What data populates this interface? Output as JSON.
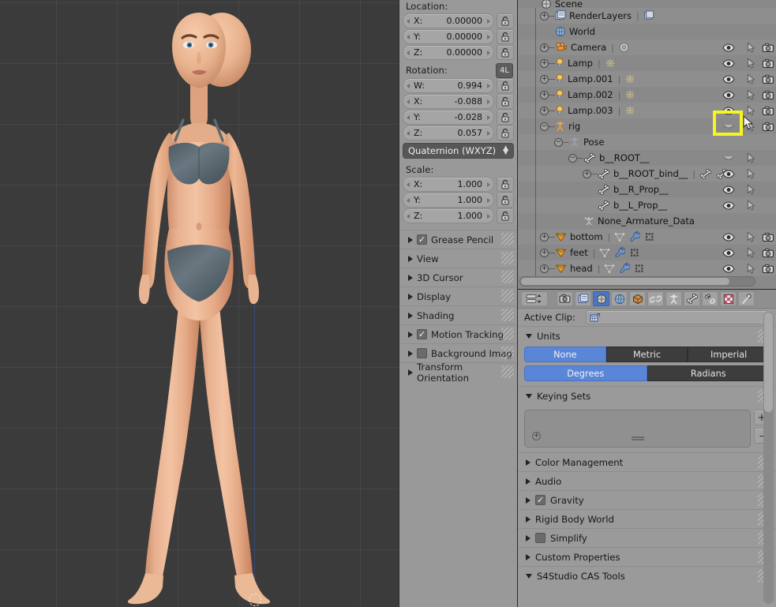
{
  "viewport": {
    "name": "3d-viewport",
    "background_color": "#3b3b3b",
    "grid_color": "#4a4a4a",
    "z_axis_color": "#3a4a7a",
    "skin_color": "#e8b591",
    "garment_color": "#5d6a72",
    "subject": "female character mesh in underwear, front view, T-pose arms down"
  },
  "npanel": {
    "location": {
      "label": "Location:",
      "fields": [
        {
          "name": "X:",
          "value": "0.00000"
        },
        {
          "name": "Y:",
          "value": "0.00000"
        },
        {
          "name": "Z:",
          "value": "0.00000"
        }
      ]
    },
    "rotation": {
      "label": "Rotation:",
      "layer_button": "4L",
      "fields": [
        {
          "name": "W:",
          "value": "0.994"
        },
        {
          "name": "X:",
          "value": "-0.088"
        },
        {
          "name": "Y:",
          "value": "-0.028"
        },
        {
          "name": "Z:",
          "value": "0.057"
        }
      ],
      "mode": "Quaternion (WXYZ)"
    },
    "scale": {
      "label": "Scale:",
      "fields": [
        {
          "name": "X:",
          "value": "1.000"
        },
        {
          "name": "Y:",
          "value": "1.000"
        },
        {
          "name": "Z:",
          "value": "1.000"
        }
      ]
    },
    "panels": [
      {
        "label": "Grease Pencil",
        "open": false,
        "checkbox": true,
        "checked": true
      },
      {
        "label": "View",
        "open": false,
        "checkbox": false
      },
      {
        "label": "3D Cursor",
        "open": false,
        "checkbox": false
      },
      {
        "label": "Display",
        "open": false,
        "checkbox": false
      },
      {
        "label": "Shading",
        "open": false,
        "checkbox": false
      },
      {
        "label": "Motion Tracking",
        "open": false,
        "checkbox": true,
        "checked": true
      },
      {
        "label": "Background Imag",
        "open": false,
        "checkbox": true,
        "checked": false
      },
      {
        "label": "Transform Orientation",
        "open": false,
        "checkbox": false
      }
    ]
  },
  "outliner": {
    "name": "outliner-editor",
    "rows": [
      {
        "label": "Scene",
        "icon": "scene-icon",
        "indent": 0,
        "expand": "none",
        "clipped": true,
        "eye": false,
        "select": false,
        "render": false,
        "extras": []
      },
      {
        "label": "RenderLayers",
        "icon": "renderlayers-icon",
        "indent": 1,
        "expand": "plus",
        "eye": false,
        "select": false,
        "render": false,
        "extras": [
          "renderlayer-data-icon"
        ]
      },
      {
        "label": "World",
        "icon": "world-icon",
        "indent": 1,
        "expand": "none",
        "eye": false,
        "select": false,
        "render": false,
        "extras": []
      },
      {
        "label": "Camera",
        "icon": "camera-object-icon",
        "indent": 1,
        "expand": "plus",
        "eye": true,
        "select": true,
        "render": true,
        "extras": [
          "camera-data-icon"
        ]
      },
      {
        "label": "Lamp",
        "icon": "lamp-object-icon",
        "indent": 1,
        "expand": "plus",
        "eye": true,
        "select": true,
        "render": true,
        "extras": [
          "lamp-data-icon"
        ]
      },
      {
        "label": "Lamp.001",
        "icon": "lamp-object-icon",
        "indent": 1,
        "expand": "plus",
        "eye": true,
        "select": true,
        "render": true,
        "extras": [
          "lamp-data-icon"
        ]
      },
      {
        "label": "Lamp.002",
        "icon": "lamp-object-icon",
        "indent": 1,
        "expand": "plus",
        "eye": true,
        "select": true,
        "render": true,
        "extras": [
          "lamp-data-icon"
        ]
      },
      {
        "label": "Lamp.003",
        "icon": "lamp-object-icon",
        "indent": 1,
        "expand": "plus",
        "eye": true,
        "select": true,
        "render": true,
        "extras": [
          "lamp-data-icon"
        ]
      },
      {
        "label": "rig",
        "icon": "armature-object-icon",
        "indent": 1,
        "expand": "minus",
        "eye": true,
        "eye_closed": true,
        "select": true,
        "render": true,
        "extras": [],
        "highlighted": true
      },
      {
        "label": "Pose",
        "icon": "pose-icon",
        "indent": 2,
        "expand": "minus",
        "eye": false,
        "select": false,
        "render": false,
        "extras": []
      },
      {
        "label": "b__ROOT__",
        "icon": "bone-icon",
        "indent": 3,
        "expand": "minus",
        "eye": true,
        "eye_closed": true,
        "select": true,
        "render": false,
        "extras": []
      },
      {
        "label": "b__ROOT_bind__",
        "icon": "bone-icon",
        "indent": 4,
        "expand": "plus",
        "eye": true,
        "select": true,
        "render": false,
        "extras": [
          "bone-icon",
          "bone-icon"
        ]
      },
      {
        "label": "b__R_Prop__",
        "icon": "bone-icon",
        "indent": 4,
        "expand": "none",
        "eye": true,
        "select": true,
        "render": false,
        "extras": []
      },
      {
        "label": "b__L_Prop__",
        "icon": "bone-icon",
        "indent": 4,
        "expand": "none",
        "eye": true,
        "select": true,
        "render": false,
        "extras": []
      },
      {
        "label": "None_Armature_Data",
        "icon": "armature-data-icon",
        "indent": 3,
        "expand": "none",
        "eye": false,
        "select": false,
        "render": false,
        "extras": []
      },
      {
        "label": "bottom",
        "icon": "mesh-object-icon",
        "indent": 1,
        "expand": "plus",
        "eye": true,
        "select": true,
        "render": true,
        "extras": [
          "mesh-data-icon",
          "modifier-icon",
          "vertexgroup-icon"
        ]
      },
      {
        "label": "feet",
        "icon": "mesh-object-icon",
        "indent": 1,
        "expand": "plus",
        "eye": true,
        "select": true,
        "render": true,
        "extras": [
          "mesh-data-icon",
          "modifier-icon",
          "vertexgroup-icon"
        ]
      },
      {
        "label": "head",
        "icon": "mesh-object-icon",
        "indent": 1,
        "expand": "plus",
        "eye": true,
        "select": true,
        "render": true,
        "extras": [
          "mesh-data-icon",
          "modifier-icon",
          "vertexgroup-icon"
        ]
      }
    ],
    "highlight_color": "#f5f522"
  },
  "properties": {
    "name": "properties-editor",
    "tabs": [
      {
        "name": "render-tab",
        "icon": "camera-back-icon",
        "active": false
      },
      {
        "name": "renderlayers-tab",
        "icon": "renderlayers-icon",
        "active": false
      },
      {
        "name": "scene-tab",
        "icon": "scene-icon",
        "active": true
      },
      {
        "name": "world-tab",
        "icon": "world-icon",
        "active": false
      },
      {
        "name": "object-tab",
        "icon": "cube-icon",
        "active": false
      },
      {
        "name": "constraints-tab",
        "icon": "chain-icon",
        "active": false
      },
      {
        "name": "armature-tab",
        "icon": "armature-icon",
        "active": false
      },
      {
        "name": "bone-tab",
        "icon": "bone-icon",
        "active": false
      },
      {
        "name": "bone-constraint-tab",
        "icon": "bone-chain-icon",
        "active": false
      },
      {
        "name": "texture-tab",
        "icon": "checker-icon",
        "active": false
      },
      {
        "name": "particles-tab",
        "icon": "particles-icon",
        "active": false
      }
    ],
    "active_clip": {
      "label": "Active Clip:",
      "value": "",
      "icon": "clip-icon"
    },
    "units": {
      "label": "Units",
      "open": true,
      "system": {
        "options": [
          "None",
          "Metric",
          "Imperial"
        ],
        "selected": "None"
      },
      "rotation": {
        "options": [
          "Degrees",
          "Radians"
        ],
        "selected": "Degrees"
      }
    },
    "keying_sets": {
      "label": "Keying Sets",
      "open": true,
      "items": [],
      "add_button": "+",
      "remove_button": "–"
    },
    "sections": [
      {
        "label": "Color Management",
        "open": false,
        "checkbox": false
      },
      {
        "label": "Audio",
        "open": false,
        "checkbox": false
      },
      {
        "label": "Gravity",
        "open": false,
        "checkbox": true,
        "checked": true
      },
      {
        "label": "Rigid Body World",
        "open": false,
        "checkbox": false
      },
      {
        "label": "Simplify",
        "open": false,
        "checkbox": true,
        "checked": false
      },
      {
        "label": "Custom Properties",
        "open": false,
        "checkbox": false
      },
      {
        "label": "S4Studio CAS Tools",
        "open": true,
        "checkbox": false
      }
    ]
  }
}
